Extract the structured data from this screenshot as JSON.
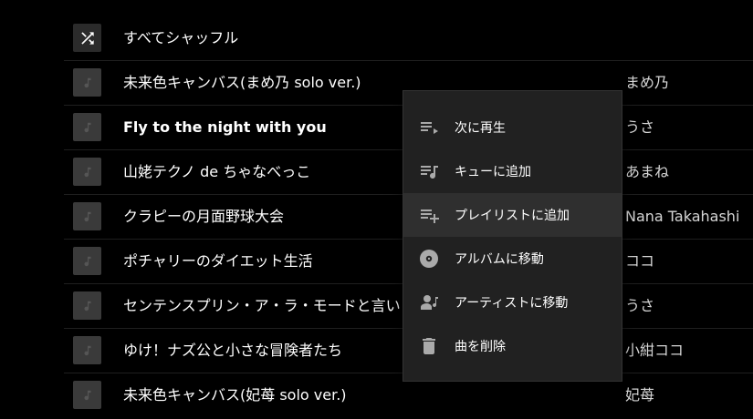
{
  "shuffle_row": {
    "label": "すべてシャッフル"
  },
  "tracks": [
    {
      "title": "未来色キャンバス(まめ乃 solo ver.)",
      "artist": "まめ乃",
      "bold": false
    },
    {
      "title": "Fly to the night with you",
      "artist": "うさ",
      "bold": true
    },
    {
      "title": "山姥テクノ de ちゃなべっこ",
      "artist": "あまね",
      "bold": false
    },
    {
      "title": "クラピーの月面野球大会",
      "artist": "Nana Takahashi",
      "bold": false
    },
    {
      "title": "ポチャリーのダイエット生活",
      "artist": "ココ",
      "bold": false
    },
    {
      "title": "センテンスプリン・ア・ラ・モードと言いましょう",
      "artist": "うさ",
      "bold": false
    },
    {
      "title": "ゆけ！ナズ公と小さな冒険者たち",
      "artist": "小紺ココ",
      "bold": false
    },
    {
      "title": "未来色キャンバス(妃苺 solo ver.)",
      "artist": "妃苺",
      "bold": false
    }
  ],
  "context_menu": {
    "items": [
      {
        "label": "次に再生",
        "icon": "play-next-icon"
      },
      {
        "label": "キューに追加",
        "icon": "add-to-queue-icon"
      },
      {
        "label": "プレイリストに追加",
        "icon": "playlist-add-icon"
      },
      {
        "label": "アルバムに移動",
        "icon": "album-icon"
      },
      {
        "label": "アーティストに移動",
        "icon": "artist-icon"
      },
      {
        "label": "曲を削除",
        "icon": "trash-icon"
      }
    ],
    "hovered_index": 2
  },
  "colors": {
    "background": "#000000",
    "menu_background": "#212121",
    "thumb": "#3a3a3a",
    "text_primary": "#ffffff",
    "text_secondary": "#d6d6d6"
  }
}
